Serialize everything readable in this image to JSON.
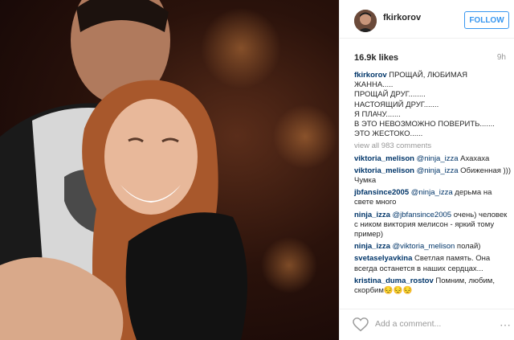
{
  "post": {
    "username": "fkirkorov",
    "follow_label": "FOLLOW",
    "likes": "16.9k likes",
    "time": "9h",
    "caption": {
      "username": "fkirkorov",
      "lines": [
        "ПРОЩАЙ, ЛЮБИМАЯ",
        "ЖАННА.....",
        "ПРОЩАЙ ДРУГ........",
        "НАСТОЯЩИЙ ДРУГ.......",
        "Я ПЛАЧУ.......",
        "В ЭТО НЕВОЗМОЖНО ПОВЕРИТЬ.......",
        "ЭТО ЖЕСТОКО......"
      ]
    },
    "view_all": "view all 983 comments",
    "comments": [
      {
        "user": "viktoria_melison",
        "mention": "@ninja_izza",
        "text": " Ахахаха"
      },
      {
        "user": "viktoria_melison",
        "mention": "@ninja_izza",
        "text": " Обиженная ))) Чумка"
      },
      {
        "user": "jbfansince2005",
        "mention": "@ninja_izza",
        "text": " дерьма на свете много"
      },
      {
        "user": "ninja_izza",
        "mention": "@jbfansince2005",
        "text": " очень) человек с ником виктория мелисон - яркий тому пример)"
      },
      {
        "user": "ninja_izza",
        "mention": "@viktoria_melison",
        "text": " полай)"
      },
      {
        "user": "svetaselyavkina",
        "mention": "",
        "text": " Светлая память. Она всегда останется в наших сердцах..."
      },
      {
        "user": "kristina_duma_rostov",
        "mention": "",
        "text": " Помним, любим, скорбим😔😔😔"
      }
    ],
    "add_comment_placeholder": "Add a comment...",
    "more_label": "⋯"
  },
  "colors": {
    "accent": "#3897f0",
    "username": "#003569",
    "muted": "#999999"
  },
  "icons": [
    "heart-icon",
    "more-options-icon"
  ]
}
